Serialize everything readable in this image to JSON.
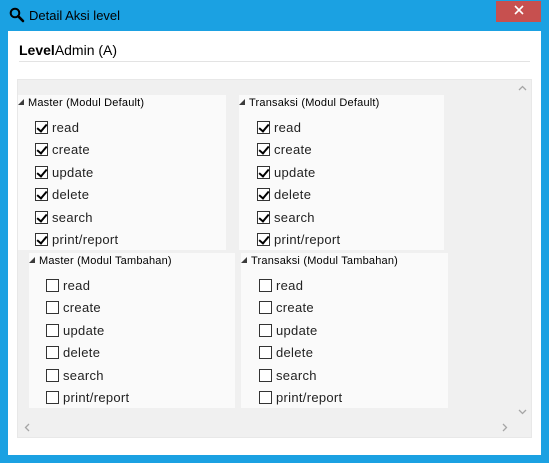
{
  "window": {
    "title": "Detail Aksi level",
    "icon": "search-icon",
    "close_icon": "close-icon",
    "titlebar_color": "#1ba1e2",
    "close_color": "#c7504f"
  },
  "level": {
    "label": "Level",
    "value": "Admin (A)"
  },
  "groups": [
    {
      "title": "Master (Modul Default)",
      "items": [
        {
          "label": "read",
          "checked": true
        },
        {
          "label": "create",
          "checked": true
        },
        {
          "label": "update",
          "checked": true
        },
        {
          "label": "delete",
          "checked": true
        },
        {
          "label": "search",
          "checked": true
        },
        {
          "label": "print/report",
          "checked": true
        }
      ]
    },
    {
      "title": "Transaksi (Modul Default)",
      "items": [
        {
          "label": "read",
          "checked": true
        },
        {
          "label": "create",
          "checked": true
        },
        {
          "label": "update",
          "checked": true
        },
        {
          "label": "delete",
          "checked": true
        },
        {
          "label": "search",
          "checked": true
        },
        {
          "label": "print/report",
          "checked": true
        }
      ]
    },
    {
      "title": "Master (Modul Tambahan)",
      "items": [
        {
          "label": "read",
          "checked": false
        },
        {
          "label": "create",
          "checked": false
        },
        {
          "label": "update",
          "checked": false
        },
        {
          "label": "delete",
          "checked": false
        },
        {
          "label": "search",
          "checked": false
        },
        {
          "label": "print/report",
          "checked": false
        }
      ]
    },
    {
      "title": "Transaksi (Modul Tambahan)",
      "items": [
        {
          "label": "read",
          "checked": false
        },
        {
          "label": "create",
          "checked": false
        },
        {
          "label": "update",
          "checked": false
        },
        {
          "label": "delete",
          "checked": false
        },
        {
          "label": "search",
          "checked": false
        },
        {
          "label": "print/report",
          "checked": false
        }
      ]
    }
  ]
}
